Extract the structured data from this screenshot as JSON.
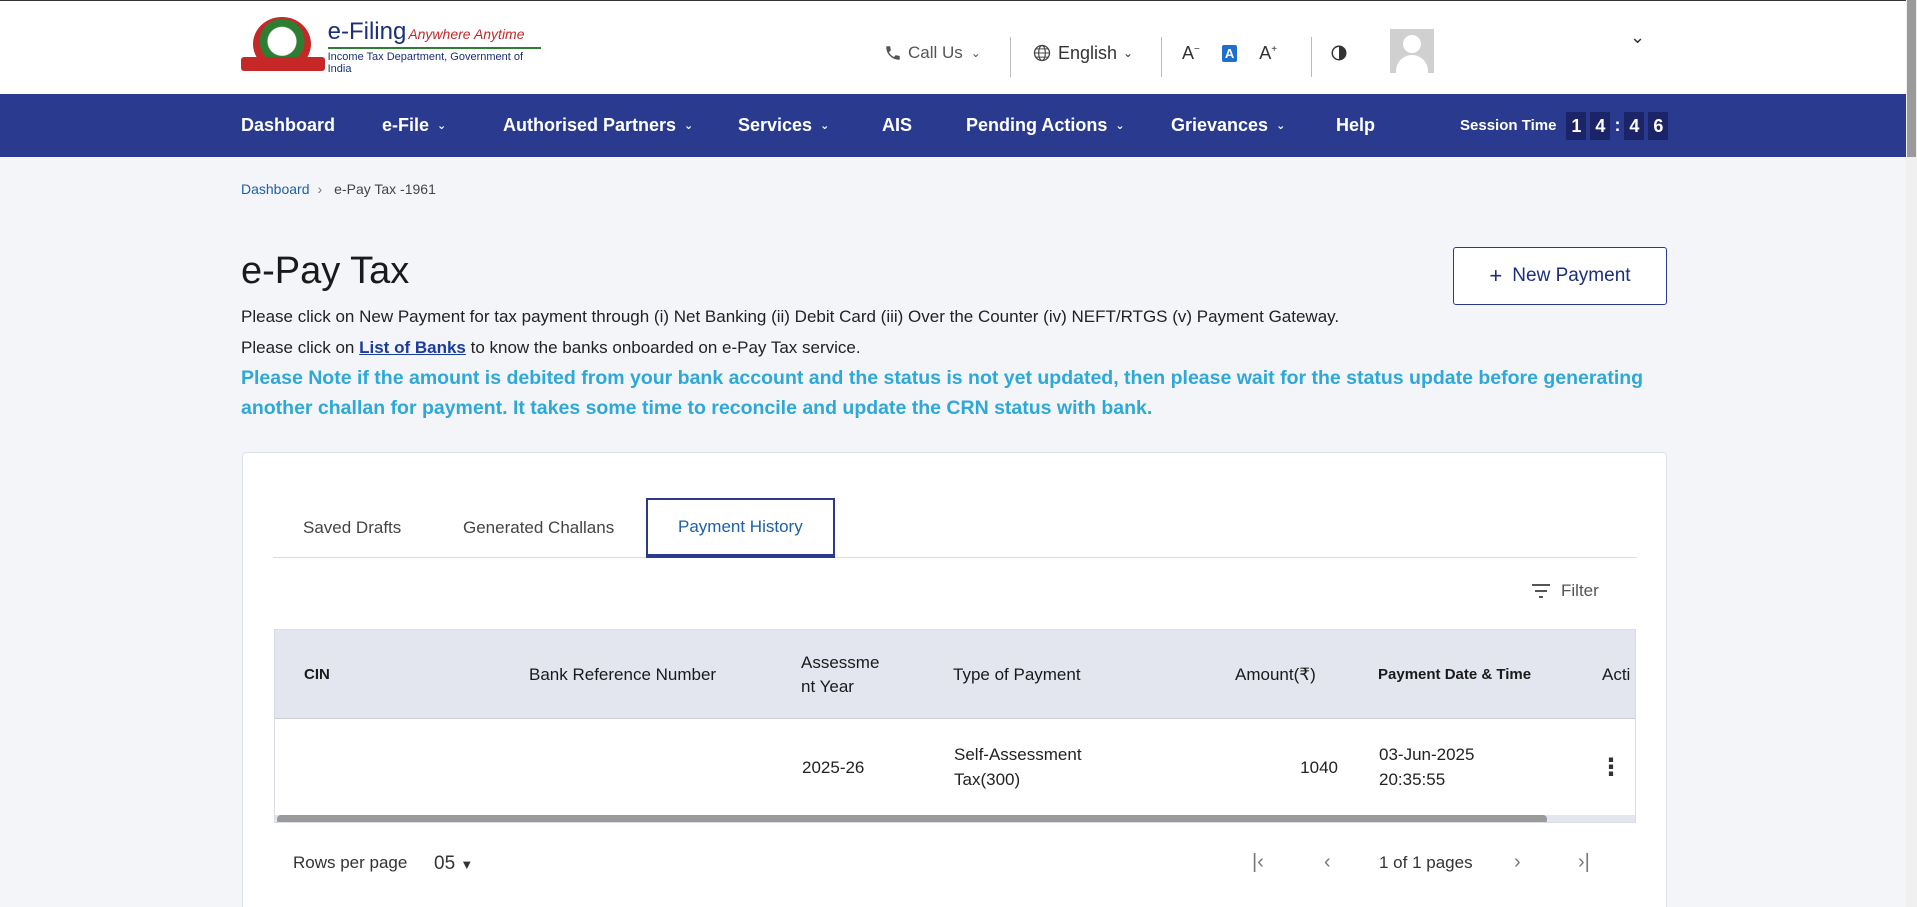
{
  "header": {
    "logo_title": "e-Filing",
    "logo_tagline": "Anywhere Anytime",
    "logo_subtitle": "Income Tax Department, Government of India",
    "call_us": "Call Us",
    "language": "English",
    "font_decrease": "A",
    "font_reset": "A",
    "font_increase": "A"
  },
  "nav": {
    "items": [
      {
        "label": "Dashboard"
      },
      {
        "label": "e-File"
      },
      {
        "label": "Authorised Partners"
      },
      {
        "label": "Services"
      },
      {
        "label": "AIS"
      },
      {
        "label": "Pending Actions"
      },
      {
        "label": "Grievances"
      },
      {
        "label": "Help"
      }
    ],
    "session_label": "Session Time",
    "session_digits": [
      "1",
      "4",
      "4",
      "6"
    ],
    "session_colon": ":"
  },
  "breadcrumb": {
    "home": "Dashboard",
    "current": "e-Pay Tax -1961"
  },
  "main": {
    "title": "e-Pay Tax",
    "new_payment_label": "New Payment",
    "info_line1": "Please click on New Payment for tax payment through (i) Net Banking (ii) Debit Card (iii) Over the Counter (iv) NEFT/RTGS (v) Payment Gateway.",
    "info_line2_prefix": "Please click on",
    "info_line2_link": "List of Banks",
    "info_line2_suffix": "to know the banks onboarded on e-Pay Tax service.",
    "note": "Please Note if the amount is debited from your bank account and the status is not yet updated, then please wait for the status update before generating another challan for payment. It takes some time to reconcile and update the CRN status with bank."
  },
  "tabs": [
    {
      "label": "Saved Drafts"
    },
    {
      "label": "Generated Challans"
    },
    {
      "label": "Payment History"
    }
  ],
  "filter_label": "Filter",
  "table": {
    "columns": [
      "CIN",
      "Bank Reference Number",
      "Assessme nt Year",
      "Type of Payment",
      "Amount(₹)",
      "Payment Date & Time",
      "Acti"
    ],
    "rows": [
      {
        "cin": "",
        "bank_ref": "",
        "assessment_year": "2025-26",
        "type_line1": "Self-Assessment",
        "type_line2": "Tax(300)",
        "amount": "1040",
        "date": "03-Jun-2025",
        "time": "20:35:55"
      }
    ]
  },
  "pager": {
    "rows_label": "Rows per page",
    "rows_value": "05",
    "page_text": "1 of 1 pages"
  },
  "colors": {
    "nav_bg": "#2a3b8f",
    "note_text": "#2ea8d6",
    "link": "#1d60a8"
  }
}
